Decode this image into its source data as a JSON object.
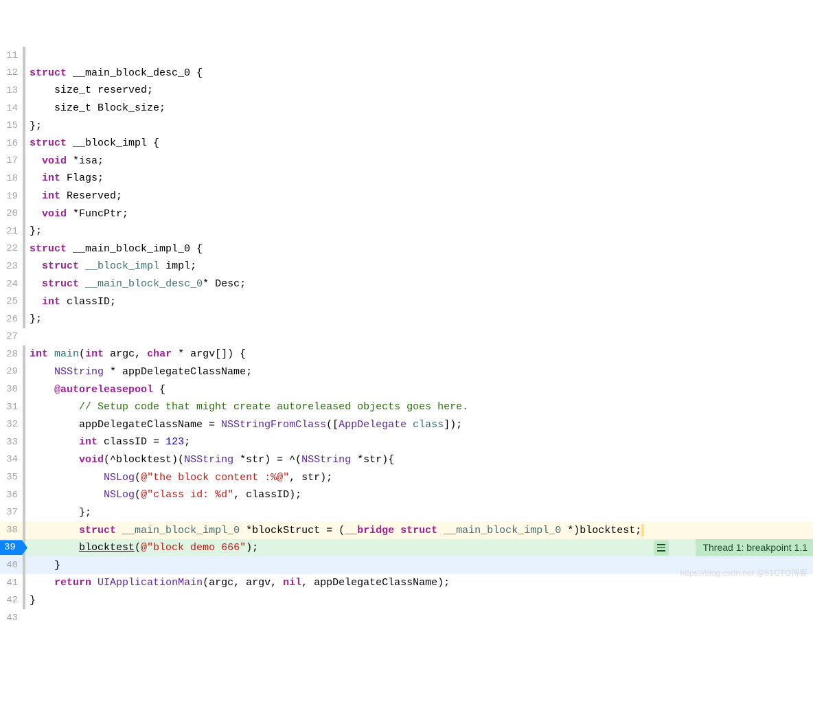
{
  "breakpoint": {
    "lineNumber": "39"
  },
  "threadBadge": {
    "text": "Thread 1: breakpoint 1.1"
  },
  "watermark": "https://blog.csdn.net @51CTO博客",
  "lines": [
    {
      "n": "11",
      "bar": true,
      "bg": "",
      "tokens": []
    },
    {
      "n": "12",
      "bar": true,
      "bg": "",
      "tokens": [
        {
          "t": "struct",
          "c": "tok-keyword"
        },
        {
          "t": " __main_block_desc_0 {"
        }
      ]
    },
    {
      "n": "13",
      "bar": true,
      "bg": "",
      "tokens": [
        {
          "t": "    size_t reserved;"
        }
      ]
    },
    {
      "n": "14",
      "bar": true,
      "bg": "",
      "tokens": [
        {
          "t": "    size_t Block_size;"
        }
      ]
    },
    {
      "n": "15",
      "bar": true,
      "bg": "",
      "tokens": [
        {
          "t": "};"
        }
      ]
    },
    {
      "n": "16",
      "bar": true,
      "bg": "",
      "tokens": [
        {
          "t": "struct",
          "c": "tok-keyword"
        },
        {
          "t": " __block_impl {"
        }
      ]
    },
    {
      "n": "17",
      "bar": true,
      "bg": "",
      "tokens": [
        {
          "t": "  "
        },
        {
          "t": "void",
          "c": "tok-keyword"
        },
        {
          "t": " *isa;"
        }
      ]
    },
    {
      "n": "18",
      "bar": true,
      "bg": "",
      "tokens": [
        {
          "t": "  "
        },
        {
          "t": "int",
          "c": "tok-keyword"
        },
        {
          "t": " Flags;"
        }
      ]
    },
    {
      "n": "19",
      "bar": true,
      "bg": "",
      "tokens": [
        {
          "t": "  "
        },
        {
          "t": "int",
          "c": "tok-keyword"
        },
        {
          "t": " Reserved;"
        }
      ]
    },
    {
      "n": "20",
      "bar": true,
      "bg": "",
      "tokens": [
        {
          "t": "  "
        },
        {
          "t": "void",
          "c": "tok-keyword"
        },
        {
          "t": " *FuncPtr;"
        }
      ]
    },
    {
      "n": "21",
      "bar": true,
      "bg": "",
      "tokens": [
        {
          "t": "};"
        }
      ]
    },
    {
      "n": "22",
      "bar": true,
      "bg": "",
      "tokens": [
        {
          "t": "struct",
          "c": "tok-keyword"
        },
        {
          "t": " __main_block_impl_0 {"
        }
      ]
    },
    {
      "n": "23",
      "bar": true,
      "bg": "",
      "tokens": [
        {
          "t": "  "
        },
        {
          "t": "struct",
          "c": "tok-keyword"
        },
        {
          "t": " "
        },
        {
          "t": "__block_impl",
          "c": "tok-type"
        },
        {
          "t": " impl;"
        }
      ]
    },
    {
      "n": "24",
      "bar": true,
      "bg": "",
      "tokens": [
        {
          "t": "  "
        },
        {
          "t": "struct",
          "c": "tok-keyword"
        },
        {
          "t": " "
        },
        {
          "t": "__main_block_desc_0",
          "c": "tok-type"
        },
        {
          "t": "* Desc;"
        }
      ]
    },
    {
      "n": "25",
      "bar": true,
      "bg": "",
      "tokens": [
        {
          "t": "  "
        },
        {
          "t": "int",
          "c": "tok-keyword"
        },
        {
          "t": " classID;"
        }
      ]
    },
    {
      "n": "26",
      "bar": true,
      "bg": "",
      "tokens": [
        {
          "t": "};"
        }
      ]
    },
    {
      "n": "27",
      "bar": false,
      "bg": "",
      "tokens": []
    },
    {
      "n": "28",
      "bar": true,
      "bg": "",
      "tokens": [
        {
          "t": "int",
          "c": "tok-keyword"
        },
        {
          "t": " "
        },
        {
          "t": "main",
          "c": "tok-call"
        },
        {
          "t": "("
        },
        {
          "t": "int",
          "c": "tok-keyword"
        },
        {
          "t": " argc, "
        },
        {
          "t": "char",
          "c": "tok-keyword"
        },
        {
          "t": " * argv[]) {"
        }
      ]
    },
    {
      "n": "29",
      "bar": true,
      "bg": "",
      "tokens": [
        {
          "t": "    "
        },
        {
          "t": "NSString",
          "c": "tok-class"
        },
        {
          "t": " * appDelegateClassName;"
        }
      ]
    },
    {
      "n": "30",
      "bar": true,
      "bg": "",
      "tokens": [
        {
          "t": "    "
        },
        {
          "t": "@autoreleasepool",
          "c": "tok-attr"
        },
        {
          "t": " {"
        }
      ]
    },
    {
      "n": "31",
      "bar": true,
      "bg": "",
      "tokens": [
        {
          "t": "        "
        },
        {
          "t": "// Setup code that might create autoreleased objects goes here.",
          "c": "tok-comment"
        }
      ]
    },
    {
      "n": "32",
      "bar": true,
      "bg": "",
      "tokens": [
        {
          "t": "        appDelegateClassName = "
        },
        {
          "t": "NSStringFromClass",
          "c": "tok-class"
        },
        {
          "t": "(["
        },
        {
          "t": "AppDelegate",
          "c": "tok-class"
        },
        {
          "t": " "
        },
        {
          "t": "class",
          "c": "tok-call"
        },
        {
          "t": "]);"
        }
      ]
    },
    {
      "n": "33",
      "bar": true,
      "bg": "",
      "tokens": [
        {
          "t": "        "
        },
        {
          "t": "int",
          "c": "tok-keyword"
        },
        {
          "t": " classID = "
        },
        {
          "t": "123",
          "c": "tok-number"
        },
        {
          "t": ";"
        }
      ]
    },
    {
      "n": "34",
      "bar": true,
      "bg": "",
      "tokens": [
        {
          "t": "        "
        },
        {
          "t": "void",
          "c": "tok-keyword"
        },
        {
          "t": "(^blocktest)("
        },
        {
          "t": "NSString",
          "c": "tok-class"
        },
        {
          "t": " *str) = ^("
        },
        {
          "t": "NSString",
          "c": "tok-class"
        },
        {
          "t": " *str){"
        }
      ]
    },
    {
      "n": "35",
      "bar": true,
      "bg": "",
      "tokens": [
        {
          "t": "            "
        },
        {
          "t": "NSLog",
          "c": "tok-class"
        },
        {
          "t": "("
        },
        {
          "t": "@\"the block content :%@\"",
          "c": "tok-string"
        },
        {
          "t": ", str);"
        }
      ]
    },
    {
      "n": "36",
      "bar": true,
      "bg": "",
      "tokens": [
        {
          "t": "            "
        },
        {
          "t": "NSLog",
          "c": "tok-class"
        },
        {
          "t": "("
        },
        {
          "t": "@\"class id: %d\"",
          "c": "tok-string"
        },
        {
          "t": ", classID);"
        }
      ]
    },
    {
      "n": "37",
      "bar": true,
      "bg": "",
      "tokens": [
        {
          "t": "        };"
        }
      ]
    },
    {
      "n": "38",
      "bar": true,
      "bg": "yellow",
      "tokens": [
        {
          "t": "        "
        },
        {
          "t": "struct",
          "c": "tok-keyword"
        },
        {
          "t": " "
        },
        {
          "t": "__main_block_impl_0",
          "c": "tok-type"
        },
        {
          "t": " *blockStruct = ("
        },
        {
          "t": "__bridge",
          "c": "tok-attr"
        },
        {
          "t": " "
        },
        {
          "t": "struct",
          "c": "tok-keyword"
        },
        {
          "t": " "
        },
        {
          "t": "__main_block_impl_0",
          "c": "tok-type"
        },
        {
          "t": " *)blocktest;"
        }
      ],
      "trailingCursor": true
    },
    {
      "n": "39",
      "bar": true,
      "bg": "green",
      "breakpoint": true,
      "tokens": [
        {
          "t": "        "
        },
        {
          "t": "blocktest",
          "c": "underline"
        },
        {
          "t": "("
        },
        {
          "t": "@\"block demo 666\"",
          "c": "tok-string"
        },
        {
          "t": ");"
        }
      ],
      "threadBadge": true
    },
    {
      "n": "40",
      "bar": true,
      "bg": "blue",
      "tokens": [
        {
          "t": "    }"
        }
      ]
    },
    {
      "n": "41",
      "bar": true,
      "bg": "",
      "tokens": [
        {
          "t": "    "
        },
        {
          "t": "return",
          "c": "tok-keyword"
        },
        {
          "t": " "
        },
        {
          "t": "UIApplicationMain",
          "c": "tok-class"
        },
        {
          "t": "(argc, argv, "
        },
        {
          "t": "nil",
          "c": "tok-nil"
        },
        {
          "t": ", appDelegateClassName);"
        }
      ]
    },
    {
      "n": "42",
      "bar": true,
      "bg": "",
      "tokens": [
        {
          "t": "}"
        }
      ]
    },
    {
      "n": "43",
      "bar": false,
      "bg": "",
      "tokens": []
    }
  ]
}
